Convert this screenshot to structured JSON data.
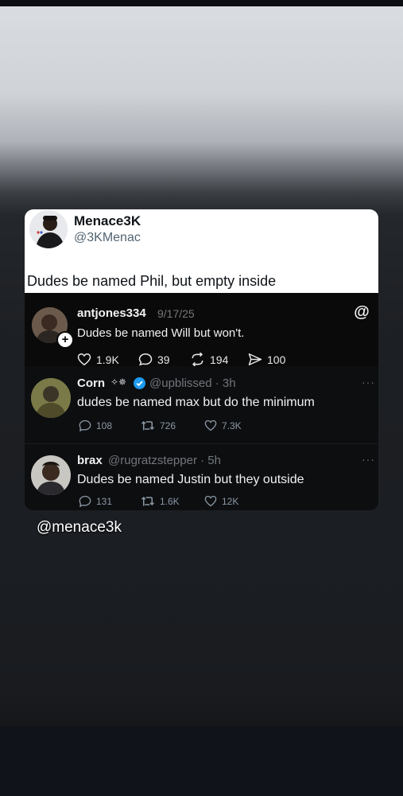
{
  "original_post": {
    "display_name": "Menace3K",
    "handle": "@3KMenac",
    "text": "Dudes be named Phil, but empty inside"
  },
  "threads_post": {
    "username": "antjones334",
    "date": "9/17/25",
    "text": "Dudes be named Will but won't.",
    "likes": "1.9K",
    "replies": "39",
    "reposts": "194",
    "shares": "100"
  },
  "x_posts": [
    {
      "display_name": "Corn",
      "badges": "✧✵",
      "handle_time": "@upblissed · 3h",
      "text": "dudes be named max but do the minimum",
      "replies": "108",
      "reposts": "726",
      "likes": "7.3K"
    },
    {
      "display_name": "brax",
      "handle_time": "@rugratzstepper · 5h",
      "text": "Dudes be named Justin but they outside",
      "replies": "131",
      "reposts": "1.6K",
      "likes": "12K"
    }
  ],
  "more_label": "···",
  "watermark": "@menace3k",
  "colors": {
    "verified": "#1d9bf0",
    "x_muted": "#8b98a5"
  }
}
